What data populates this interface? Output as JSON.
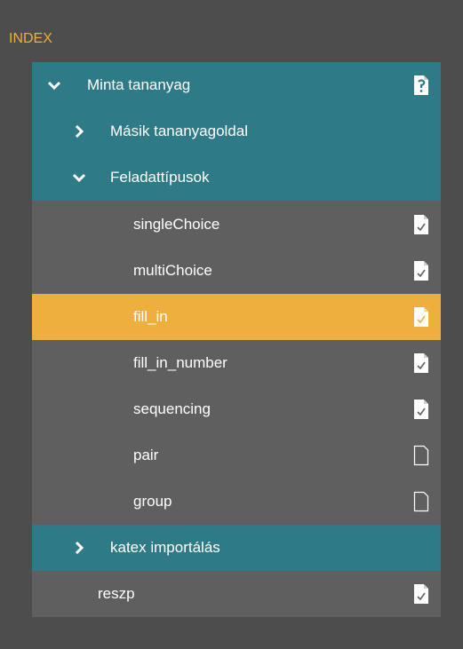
{
  "panel": {
    "title": "INDEX"
  },
  "tree": [
    {
      "key": "minta",
      "label": "Minta tananyag",
      "expanded": true,
      "icon": "help-document-icon"
    },
    {
      "key": "masik",
      "label": "Másik tananyagoldal",
      "expanded": false
    },
    {
      "key": "feladat",
      "label": "Feladattípusok",
      "expanded": true
    },
    {
      "key": "single",
      "label": "singleChoice",
      "icon": "checked-document-icon"
    },
    {
      "key": "multi",
      "label": "multiChoice",
      "icon": "checked-document-icon"
    },
    {
      "key": "fill",
      "label": "fill_in",
      "icon": "checked-document-icon",
      "selected": true
    },
    {
      "key": "fillnum",
      "label": "fill_in_number",
      "icon": "checked-document-icon"
    },
    {
      "key": "seq",
      "label": "sequencing",
      "icon": "checked-document-icon"
    },
    {
      "key": "pair",
      "label": "pair",
      "icon": "empty-document-icon"
    },
    {
      "key": "group",
      "label": "group",
      "icon": "empty-document-icon"
    },
    {
      "key": "katex",
      "label": "katex importálás",
      "expanded": false
    },
    {
      "key": "reszp",
      "label": "reszp",
      "icon": "checked-document-icon"
    }
  ],
  "colors": {
    "background": "#4d4d4d",
    "teal": "#2e7b87",
    "item": "#5f5f5f",
    "selected": "#eeaf3f",
    "title": "#f0ae3a",
    "text": "#ffffff"
  }
}
